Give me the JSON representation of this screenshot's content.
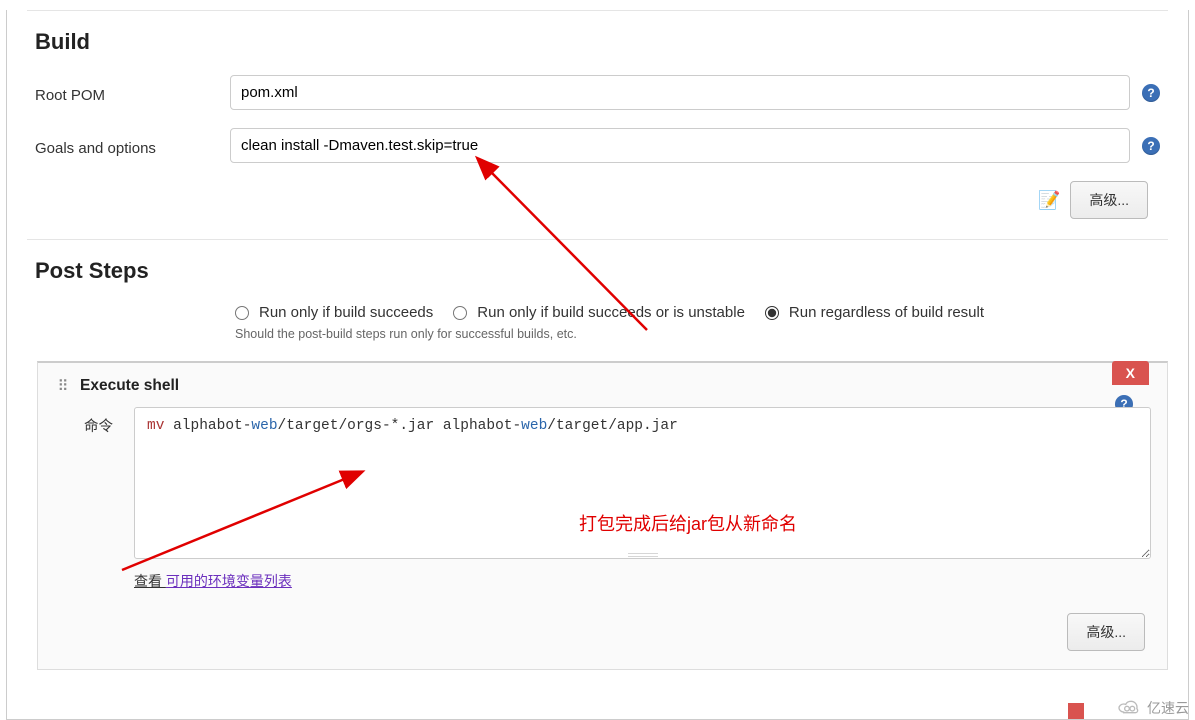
{
  "build": {
    "title": "Build",
    "root_pom_label": "Root POM",
    "root_pom_value": "pom.xml",
    "goals_label": "Goals and options",
    "goals_value": "clean install -Dmaven.test.skip=true",
    "advanced_label": "高级..."
  },
  "post_steps": {
    "title": "Post Steps",
    "radio": {
      "opt1": "Run only if build succeeds",
      "opt2": "Run only if build succeeds or is unstable",
      "opt3": "Run regardless of build result",
      "selected_index": 2
    },
    "helptext": "Should the post-build steps run only for successful builds, etc."
  },
  "execute_shell": {
    "title": "Execute shell",
    "delete_label": "X",
    "cmd_label": "命令",
    "cmd_value_display": "mv alphabot-web/target/orgs-*.jar alphabot-web/target/app.jar",
    "view_prefix": "查看 ",
    "env_link": "可用的环境变量列表",
    "advanced_label": "高级..."
  },
  "annotations": {
    "rename_note": "打包完成后给jar包从新命名"
  },
  "watermark": {
    "text": "亿速云"
  },
  "icons": {
    "help": "?",
    "edit": "📝",
    "drag": "⠿"
  }
}
